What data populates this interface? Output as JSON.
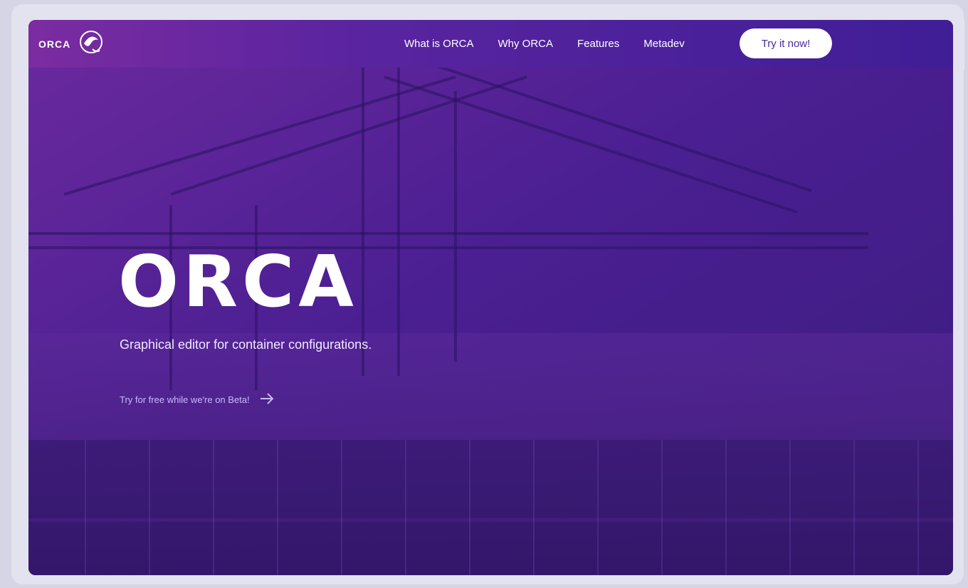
{
  "brand": {
    "name": "ORCA",
    "logo_icon": "orca-whale-logo-icon"
  },
  "nav": {
    "links": [
      "What is ORCA",
      "Why ORCA",
      "Features",
      "Metadev"
    ],
    "cta": "Try it now!"
  },
  "hero": {
    "title": "ORCA",
    "subtitle": "Graphical editor for container configurations.",
    "beta_link": "Try for free while we're on Beta!",
    "arrow_icon": "arrow-right-icon"
  },
  "colors": {
    "accent": "#5a24a0",
    "navbar_left": "#7b2ca0",
    "navbar_right": "#3f1e96",
    "hero_purple": "#4a1f8d",
    "cta_text": "#4b2aa3",
    "link": "#cbb8ff"
  }
}
